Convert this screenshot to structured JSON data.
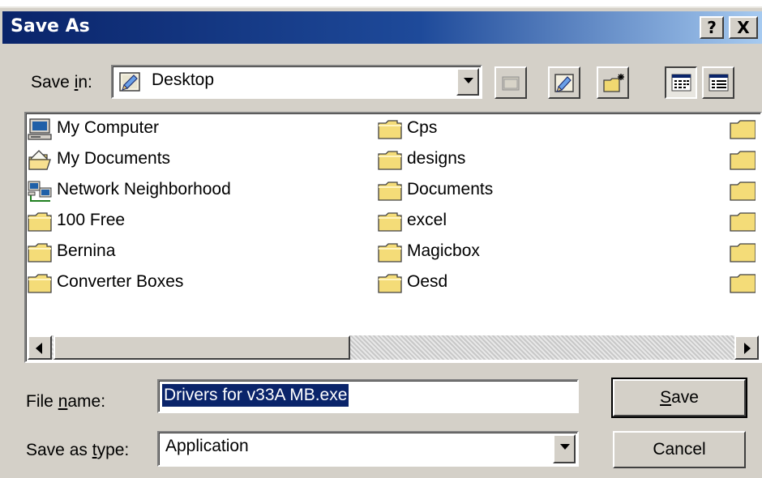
{
  "dialog": {
    "title": "Save As",
    "help_label": "?",
    "close_label": "X"
  },
  "save_in": {
    "label_prefix": "Save ",
    "label_accel": "i",
    "label_suffix": "n:",
    "value": "Desktop",
    "icon": "desktop-icon"
  },
  "toolbar": {
    "buttons": [
      "up-one-level-icon",
      "desktop-icon",
      "new-folder-icon",
      "list-view-icon",
      "details-view-icon"
    ]
  },
  "files": {
    "column1": [
      {
        "name": "My Computer",
        "icon": "my-computer-icon"
      },
      {
        "name": "My Documents",
        "icon": "my-documents-icon"
      },
      {
        "name": "Network Neighborhood",
        "icon": "network-neighborhood-icon"
      },
      {
        "name": "100 Free",
        "icon": "folder-icon"
      },
      {
        "name": "Bernina",
        "icon": "folder-icon"
      },
      {
        "name": "Converter Boxes",
        "icon": "folder-icon"
      }
    ],
    "column2": [
      {
        "name": "Cps",
        "icon": "folder-icon"
      },
      {
        "name": "designs",
        "icon": "folder-icon"
      },
      {
        "name": "Documents",
        "icon": "folder-icon"
      },
      {
        "name": "excel",
        "icon": "folder-icon"
      },
      {
        "name": "Magicbox",
        "icon": "folder-icon"
      },
      {
        "name": "Oesd",
        "icon": "folder-icon"
      }
    ]
  },
  "file_name": {
    "label_prefix": "File ",
    "label_accel": "n",
    "label_suffix": "ame:",
    "value": "Drivers for v33A MB.exe"
  },
  "save_as_type": {
    "label_prefix": "Save as ",
    "label_accel": "t",
    "label_suffix": "ype:",
    "value": "Application"
  },
  "buttons": {
    "save_accel": "S",
    "save_rest": "ave",
    "cancel": "Cancel"
  },
  "colors": {
    "titlebar_start": "#0a246a",
    "titlebar_end": "#a6caf0",
    "face": "#d4d0c8",
    "selection": "#0a246a"
  }
}
